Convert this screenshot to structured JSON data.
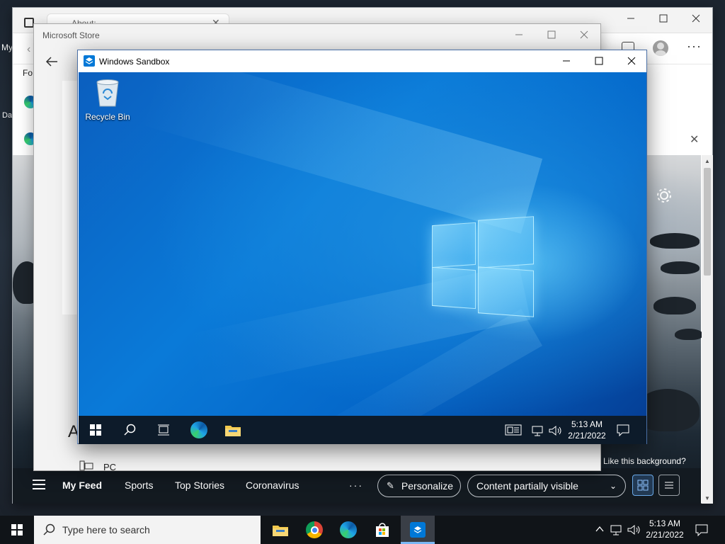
{
  "host": {
    "desktop_left_labels": [
      "My",
      "Da"
    ],
    "edge": {
      "tab_title": "About:..",
      "left_text": "Fo",
      "bottom_nav": [
        "My Feed",
        "Sports",
        "Top Stories",
        "Coronavirus"
      ],
      "more_label": "···",
      "personalize_label": "Personalize",
      "content_visibility": "Content partially visible",
      "background_prompt": "Like this background?"
    },
    "store": {
      "title": "Microsoft Store",
      "heading_letter": "A",
      "item_label": "PC"
    }
  },
  "sandbox": {
    "title": "Windows Sandbox",
    "desktop_icon_label": "Recycle Bin",
    "clock_time": "5:13 AM",
    "clock_date": "2/21/2022"
  },
  "taskbar": {
    "search_placeholder": "Type here to search",
    "clock_time": "5:13 AM",
    "clock_date": "2/21/2022"
  },
  "colors": {
    "accent": "#0078d7",
    "sandbox_taskbar": "#0d1b2a",
    "host_taskbar": "#101418"
  }
}
